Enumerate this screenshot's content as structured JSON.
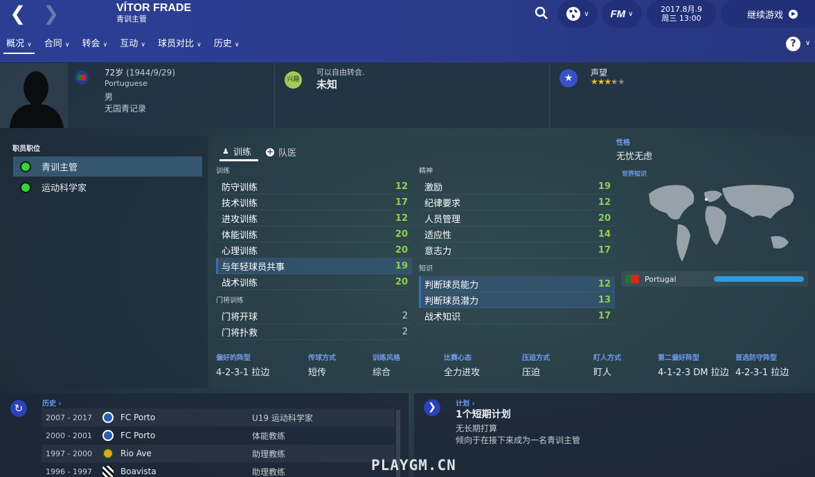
{
  "header": {
    "name": "VÍTOR FRADE",
    "role": "青训主管",
    "date": "2017.8月.9",
    "time": "周三 13:00",
    "continue": "继续游戏",
    "fm": "FM"
  },
  "menu": [
    {
      "label": "概况"
    },
    {
      "label": "合同"
    },
    {
      "label": "转会"
    },
    {
      "label": "互动"
    },
    {
      "label": "球员对比"
    },
    {
      "label": "历史"
    }
  ],
  "help": "?",
  "profile": {
    "age": "72岁",
    "dob": "(1944/9/29)",
    "nationality": "Portuguese",
    "gender": "男",
    "youth": "无国青记录",
    "interest_badge": "兴趣",
    "transfer_status": "可以自由转会.",
    "transfer_value": "未知",
    "reputation_label": "声望",
    "reputation_stars": 3.5
  },
  "roles": {
    "title": "职员职位",
    "items": [
      {
        "label": "青训主管",
        "active": true
      },
      {
        "label": "运动科学家",
        "active": false
      }
    ]
  },
  "tabs": [
    {
      "label": "训练",
      "icon": "person-icon",
      "active": true
    },
    {
      "label": "队医",
      "icon": "plus-icon",
      "active": false
    }
  ],
  "training": {
    "title": "训练",
    "items": [
      {
        "name": "防守训练",
        "value": "12"
      },
      {
        "name": "技术训练",
        "value": "17"
      },
      {
        "name": "进攻训练",
        "value": "12"
      },
      {
        "name": "体能训练",
        "value": "20"
      },
      {
        "name": "心理训练",
        "value": "20"
      },
      {
        "name": "与年轻球员共事",
        "value": "19"
      },
      {
        "name": "战术训练",
        "value": "20"
      }
    ]
  },
  "gk": {
    "title": "门将训练",
    "items": [
      {
        "name": "门将开球",
        "value": "2"
      },
      {
        "name": "门将扑救",
        "value": "2"
      }
    ]
  },
  "mental": {
    "title": "精神",
    "items": [
      {
        "name": "激励",
        "value": "19"
      },
      {
        "name": "纪律要求",
        "value": "12"
      },
      {
        "name": "人员管理",
        "value": "20"
      },
      {
        "name": "适应性",
        "value": "14"
      },
      {
        "name": "意志力",
        "value": "17"
      }
    ]
  },
  "knowledge": {
    "title": "知识",
    "items": [
      {
        "name": "判断球员能力",
        "value": "12"
      },
      {
        "name": "判断球员潜力",
        "value": "13"
      },
      {
        "name": "战术知识",
        "value": "17"
      }
    ]
  },
  "personality": {
    "label": "性格",
    "value": "无忧无虑"
  },
  "world": {
    "label": "世界知识",
    "country": "Portugal",
    "level": 1.0
  },
  "prefs": [
    {
      "label": "偏好的阵型",
      "value": "4-2-3-1 拉边"
    },
    {
      "label": "传球方式",
      "value": "短传"
    },
    {
      "label": "训练风格",
      "value": "综合"
    },
    {
      "label": "比赛心态",
      "value": "全力进攻"
    },
    {
      "label": "压迫方式",
      "value": "压迫"
    },
    {
      "label": "盯人方式",
      "value": "盯人"
    },
    {
      "label": "第二偏好阵型",
      "value": "4-1-2-3 DM 拉边"
    },
    {
      "label": "首选防守阵型",
      "value": "4-2-3-1 拉边"
    }
  ],
  "history": {
    "label": "历史",
    "rows": [
      {
        "years": "2007 - 2017",
        "club": "FC Porto",
        "role": "U19 运动科学家"
      },
      {
        "years": "2000 - 2001",
        "club": "FC Porto",
        "role": "体能教练"
      },
      {
        "years": "1997 - 2000",
        "club": "Rio Ave",
        "role": "助理教练"
      },
      {
        "years": "1996 - 1997",
        "club": "Boavista",
        "role": "助理教练"
      }
    ]
  },
  "plans": {
    "label": "计划",
    "title": "1个短期计划",
    "line1": "无长期打算",
    "line2": "倾向于在接下来成为一名青训主管"
  },
  "watermark": "PLAYGM.CN"
}
